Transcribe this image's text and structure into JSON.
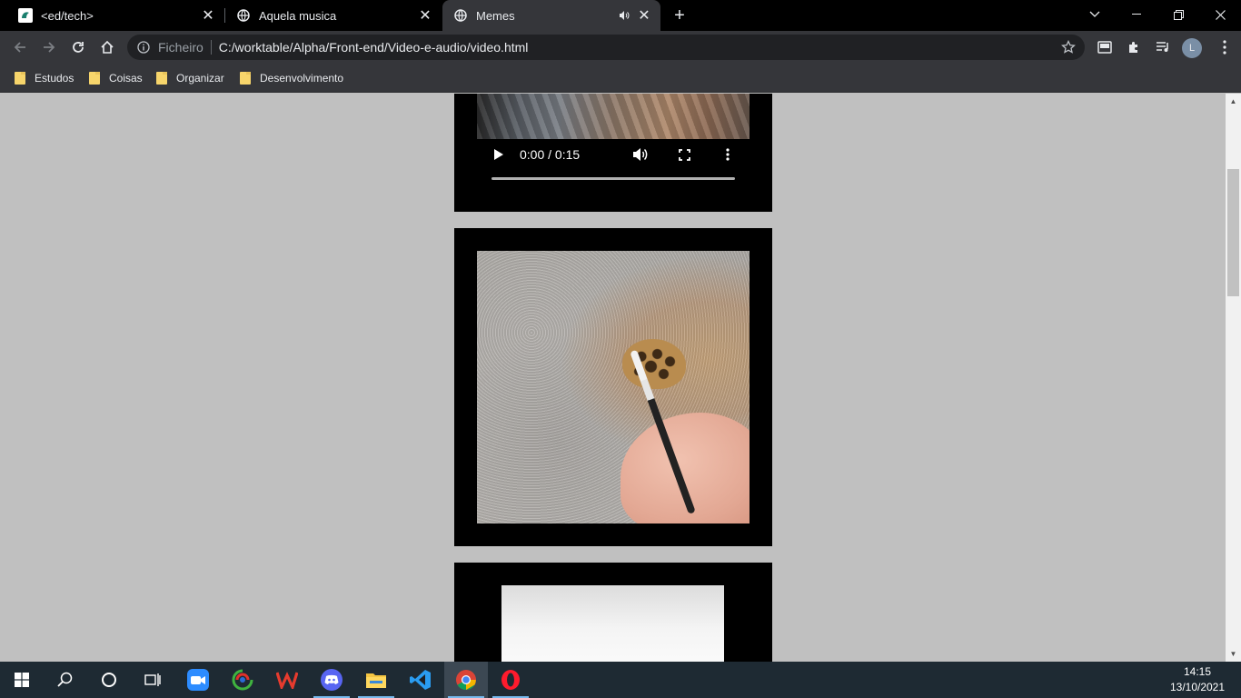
{
  "browser": {
    "tabs": [
      {
        "title": "<ed/tech>",
        "icon": "edtech-favicon-icon",
        "active": false
      },
      {
        "title": "Aquela musica",
        "icon": "globe-icon",
        "active": false
      },
      {
        "title": "Memes",
        "icon": "globe-icon",
        "active": true,
        "audio": true
      }
    ],
    "address": {
      "scheme_label": "Ficheiro",
      "url": "C:/worktable/Alpha/Front-end/Video-e-audio/video.html"
    },
    "profile_initial": "L",
    "bookmarks": [
      "Estudos",
      "Coisas",
      "Organizar",
      "Desenvolvimento"
    ]
  },
  "page": {
    "video1": {
      "time": "0:00 / 0:15",
      "progress": 0
    },
    "background_color": "#c0c0c0",
    "card_color": "#000000"
  },
  "taskbar": {
    "apps": [
      "start",
      "search",
      "cortana",
      "task-view",
      "zoom",
      "greenshot",
      "wps-office",
      "discord",
      "file-explorer",
      "vscode",
      "chrome",
      "opera"
    ],
    "clock_time": "14:15",
    "clock_date": "13/10/2021"
  }
}
